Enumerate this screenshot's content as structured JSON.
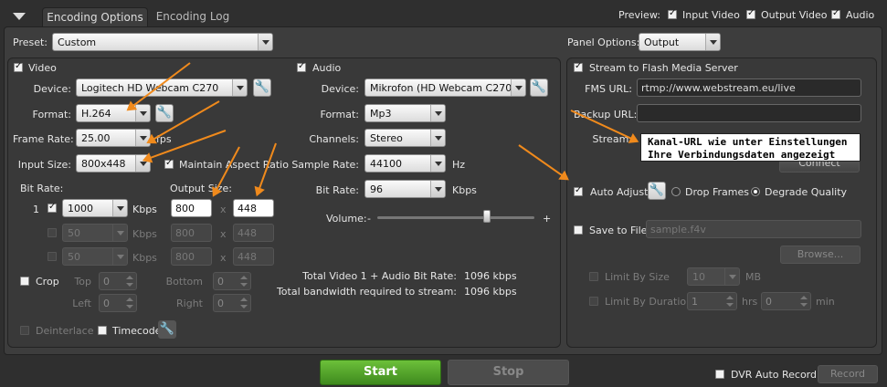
{
  "tabs": [
    {
      "label": "Encoding Options"
    },
    {
      "label": "Encoding Log"
    }
  ],
  "preview": {
    "label": "Preview:",
    "input_video": "Input Video",
    "output_video": "Output Video",
    "audio": "Audio"
  },
  "preset": {
    "label": "Preset:",
    "value": "Custom"
  },
  "panel_options": {
    "label": "Panel Options:",
    "value": "Output"
  },
  "video": {
    "title": "Video",
    "device_label": "Device:",
    "device": "Logitech HD Webcam C270",
    "format_label": "Format:",
    "format": "H.264",
    "frame_rate_label": "Frame Rate:",
    "frame_rate": "25.00",
    "fps": "fps",
    "input_size_label": "Input Size:",
    "input_size": "800x448",
    "maintain_aspect": "Maintain Aspect Ratio",
    "bit_rate_label": "Bit Rate:",
    "output_size_label": "Output Size:",
    "rows": [
      {
        "num": "1",
        "bitrate": "1000",
        "unit": "Kbps",
        "w": "800",
        "x": "x",
        "h": "448"
      },
      {
        "num": "",
        "bitrate": "50",
        "unit": "Kbps",
        "w": "800",
        "x": "x",
        "h": "448"
      },
      {
        "num": "",
        "bitrate": "50",
        "unit": "Kbps",
        "w": "800",
        "x": "x",
        "h": "448"
      }
    ],
    "crop": "Crop",
    "top": "Top",
    "bottom": "Bottom",
    "left": "Left",
    "right": "Right",
    "zero": "0",
    "deinterlace": "Deinterlace",
    "timecode": "Timecode"
  },
  "audio": {
    "title": "Audio",
    "device_label": "Device:",
    "device": "Mikrofon (HD Webcam C270)",
    "format_label": "Format:",
    "format": "Mp3",
    "channels_label": "Channels:",
    "channels": "Stereo",
    "sample_rate_label": "Sample Rate:",
    "sample_rate": "44100",
    "hz": "Hz",
    "bit_rate_label": "Bit Rate:",
    "bit_rate": "96",
    "kbps": "Kbps",
    "volume_label": "Volume:",
    "minus": "-",
    "plus": "+",
    "volume_level": 0.7
  },
  "totals": {
    "line1": "Total Video 1 + Audio Bit Rate:",
    "val1": "1096 kbps",
    "line2": "Total bandwidth required to stream:",
    "val2": "1096 kbps"
  },
  "fms": {
    "title": "Stream to Flash Media Server",
    "url_label": "FMS URL:",
    "url": "rtmp://www.webstream.eu/live",
    "backup_label": "Backup URL:",
    "backup": "",
    "stream_label": "Stream:",
    "connect": "Connect",
    "tooltip1": "Kanal-URL wie unter Einstellungen",
    "tooltip2": "Ihre Verbindungsdaten angezeigt",
    "auto_adjust": "Auto Adjust",
    "drop_frames": "Drop Frames",
    "degrade_quality": "Degrade Quality",
    "save_to_file": "Save to File",
    "file": "sample.f4v",
    "browse": "Browse...",
    "limit_size": "Limit By Size",
    "size_val": "10",
    "mb": "MB",
    "limit_duration": "Limit By Duration",
    "hrs_val": "1",
    "hrs": "hrs",
    "min_val": "0",
    "min": "min"
  },
  "bottom": {
    "start": "Start",
    "stop": "Stop",
    "dvr": "DVR Auto Record",
    "record": "Record"
  },
  "colors": {
    "accent": "#f08a1c",
    "start_green": "#4e9a2a"
  }
}
